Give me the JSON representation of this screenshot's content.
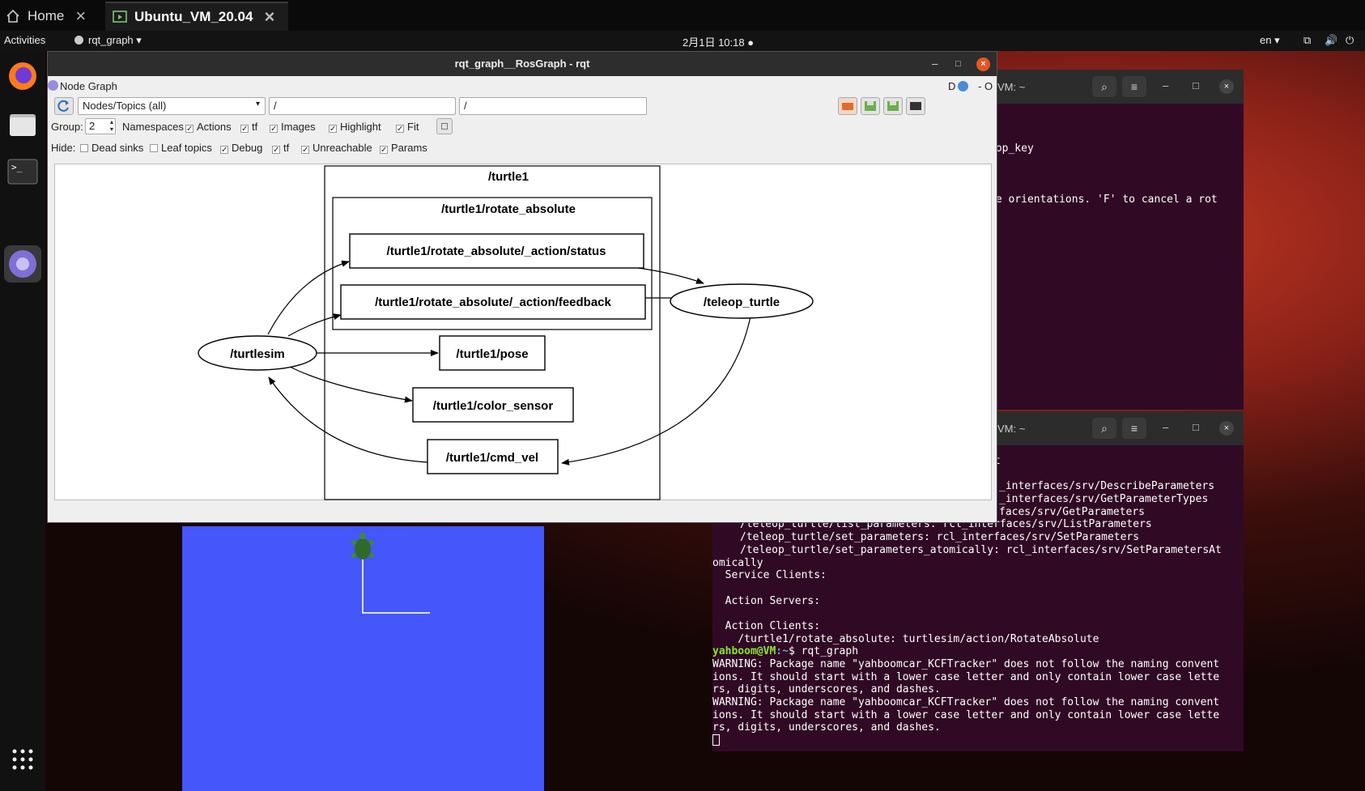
{
  "host": {
    "tabs": [
      {
        "label": "Home"
      },
      {
        "label": "Ubuntu_VM_20.04"
      }
    ]
  },
  "topbar": {
    "activities": "Activities",
    "app_menu": "rqt_graph",
    "clock": "2月1日  10:18",
    "lang": "en"
  },
  "rqt": {
    "window_title": "rqt_graph__RosGraph - rqt",
    "plugin_title": "Node Graph",
    "plugin_right": "D",
    "plugin_right2": "- O",
    "mode_select": "Nodes/Topics (all)",
    "filter1": "/",
    "filter2": "/",
    "group_label": "Group:",
    "group_value": "2",
    "namespaces": "Namespaces",
    "actions": "Actions",
    "tf": "tf",
    "images": "Images",
    "highlight": "Highlight",
    "fit": "Fit",
    "hide_label": "Hide:",
    "dead_sinks": "Dead sinks",
    "leaf_topics": "Leaf topics",
    "debug": "Debug",
    "tf2": "tf",
    "unreachable": "Unreachable",
    "params": "Params"
  },
  "graph": {
    "group_turtle1": "/turtle1",
    "group_rotate": "/turtle1/rotate_absolute",
    "status": "/turtle1/rotate_absolute/_action/status",
    "feedback": "/turtle1/rotate_absolute/_action/feedback",
    "teleop": "/teleop_turtle",
    "turtlesim": "/turtlesim",
    "pose": "/turtle1/pose",
    "color": "/turtle1/color_sensor",
    "cmd_vel": "/turtle1/cmd_vel"
  },
  "term1": {
    "title": "VM: ~",
    "lines": [
      "eop_key",
      "",
      "",
      "",
      "te orientations. 'F' to cancel a rot"
    ]
  },
  "term2": {
    "title": "VM: ~",
    "lines": [
      "t",
      "",
      "_interfaces/srv/DescribeParameters",
      "_interfaces/srv/GetParameterTypes",
      "faces/srv/GetParameters",
      "/teleop_turtle/list_parameters: rcl_interfaces/srv/ListParameters",
      "/teleop_turtle/set_parameters: rcl_interfaces/srv/SetParameters",
      "/teleop_turtle/set_parameters_atomically: rcl_interfaces/srv/SetParametersAt",
      "omically",
      "  Service Clients:",
      "",
      "  Action Servers:",
      "",
      "  Action Clients:",
      "    /turtle1/rotate_absolute: turtlesim/action/RotateAbsolute",
      "$ rqt_graph",
      "WARNING: Package name \"yahboomcar_KCFTracker\" does not follow the naming convent",
      "ions. It should start with a lower case letter and only contain lower case lette",
      "rs, digits, underscores, and dashes.",
      "WARNING: Package name \"yahboomcar_KCFTracker\" does not follow the naming convent",
      "ions. It should start with a lower case letter and only contain lower case lette",
      "rs, digits, underscores, and dashes."
    ],
    "prompt_user": "yahboom@VM",
    "prompt_path": ":~"
  },
  "colors": {
    "accent": "#e95420",
    "terminal_bg": "#300a24",
    "turtlesim_bg": "#4556fb"
  }
}
